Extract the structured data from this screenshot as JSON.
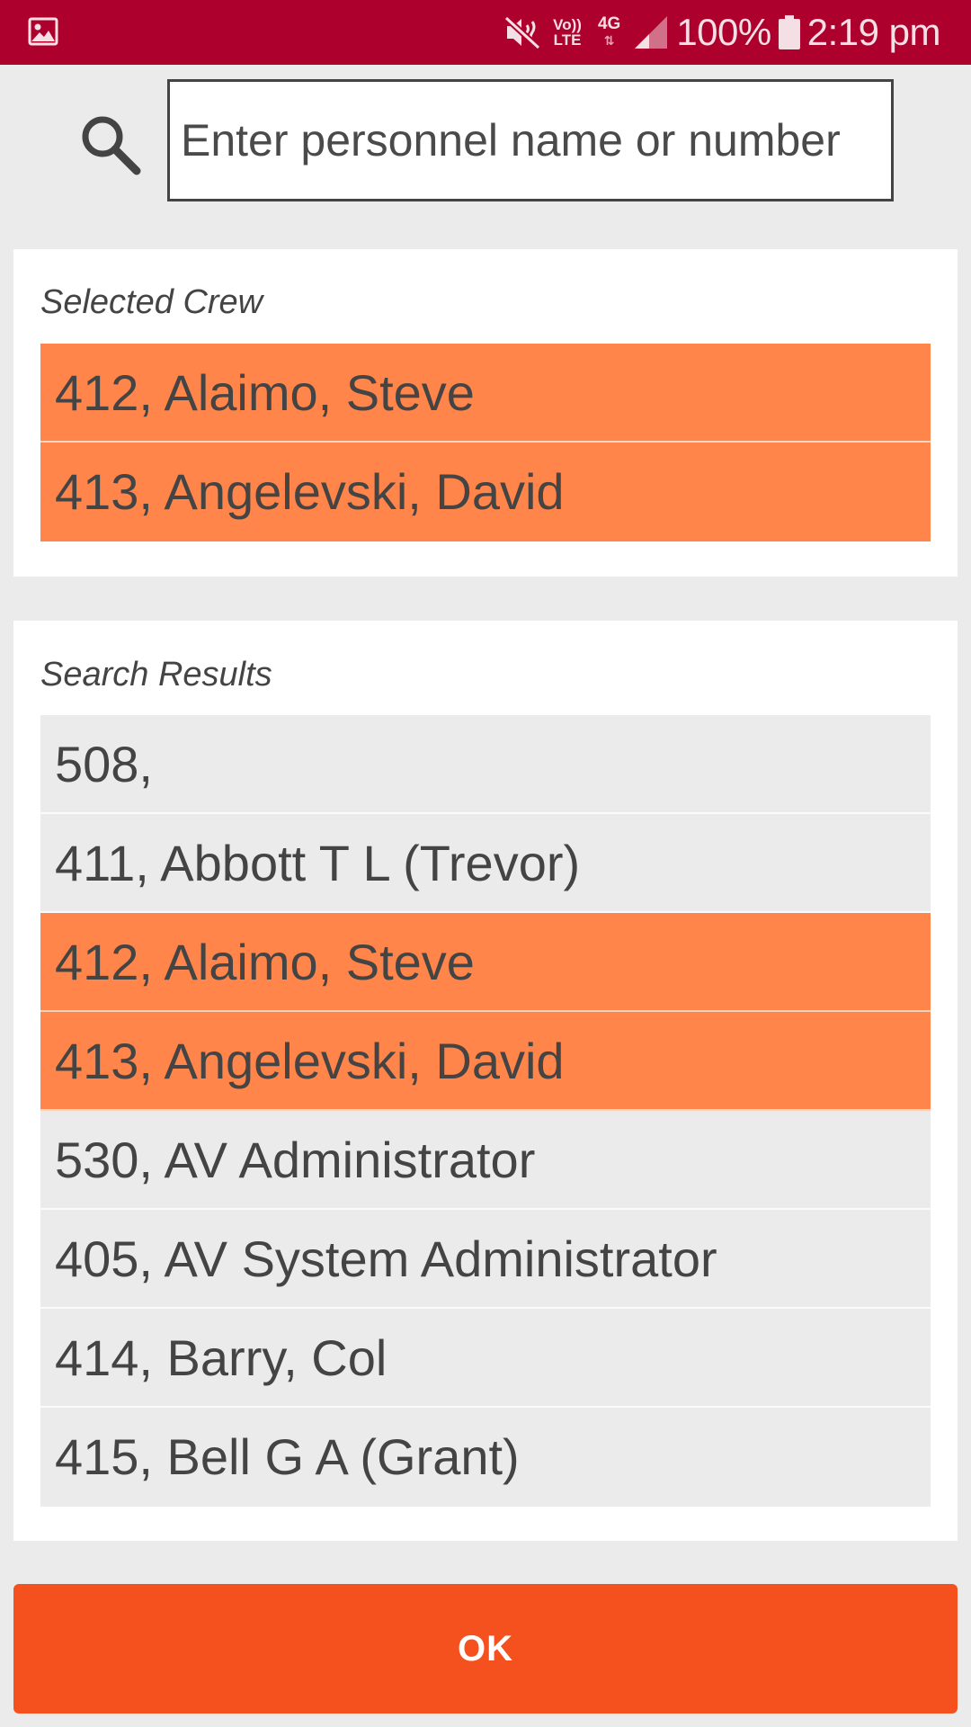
{
  "status_bar": {
    "notification_icon": "gallery-icon",
    "volte_label_top": "Vo))",
    "volte_label_bottom": "LTE",
    "network_label": "4G",
    "battery_percent": "100%",
    "time": "2:19 pm",
    "background_color": "#ad002d"
  },
  "search": {
    "icon": "search-icon",
    "placeholder": "Enter personnel name or number",
    "value": ""
  },
  "selected_crew": {
    "label": "Selected Crew",
    "items": [
      {
        "text": "412, Alaimo, Steve"
      },
      {
        "text": "413, Angelevski, David"
      }
    ]
  },
  "search_results": {
    "label": "Search Results",
    "items": [
      {
        "text": "508,",
        "selected": false
      },
      {
        "text": "411, Abbott T L (Trevor)",
        "selected": false
      },
      {
        "text": "412, Alaimo, Steve",
        "selected": true
      },
      {
        "text": "413, Angelevski, David",
        "selected": true
      },
      {
        "text": "530, AV Administrator",
        "selected": false
      },
      {
        "text": "405, AV System Administrator",
        "selected": false
      },
      {
        "text": "414, Barry, Col",
        "selected": false
      },
      {
        "text": "415, Bell G A (Grant)",
        "selected": false
      }
    ]
  },
  "ok_button": {
    "label": "OK"
  },
  "colors": {
    "accent": "#f5511e",
    "selected_row": "#ff854a",
    "row_background": "#ebebeb"
  }
}
